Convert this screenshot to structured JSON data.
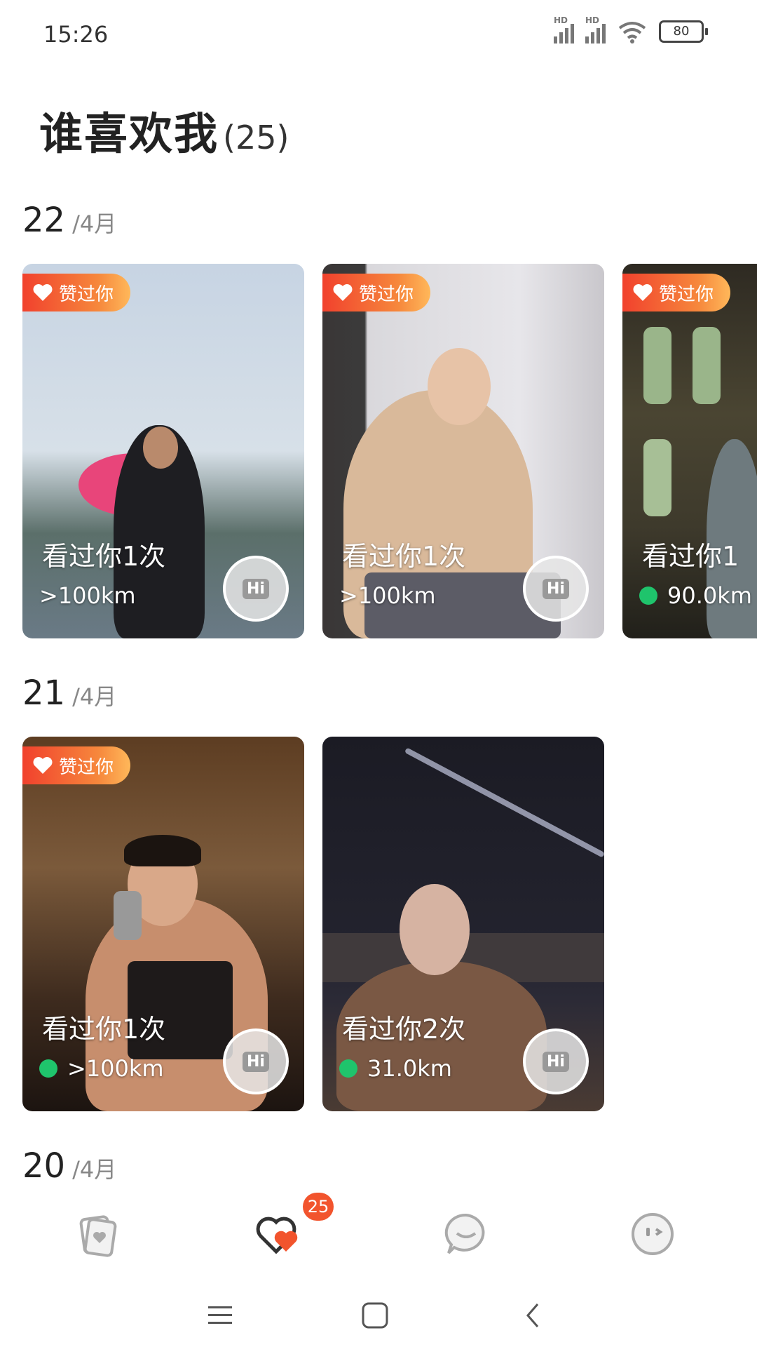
{
  "status_bar": {
    "time": "15:26",
    "battery": "80",
    "hd_label": "HD"
  },
  "header": {
    "title": "谁喜欢我",
    "count": "(25)"
  },
  "groups": [
    {
      "day": "22",
      "month": "/4月"
    },
    {
      "day": "21",
      "month": "/4月"
    },
    {
      "day": "20",
      "month": "/4月"
    }
  ],
  "cards": [
    {
      "badge": "赞过你",
      "seen": "看过你1次",
      "distance": ">100km",
      "online": false
    },
    {
      "badge": "赞过你",
      "seen": "看过你1次",
      "distance": ">100km",
      "online": false
    },
    {
      "badge": "赞过你",
      "seen": "看过你1",
      "distance": "90.0km",
      "online": true
    },
    {
      "badge": "赞过你",
      "seen": "看过你1次",
      "distance": ">100km",
      "online": true
    },
    {
      "badge": "",
      "seen": "看过你2次",
      "distance": "31.0km",
      "online": true
    }
  ],
  "hi_label": "Hi",
  "bottom_nav": {
    "badge_count": "25",
    "items": [
      "cards-icon",
      "likes-heart-icon",
      "chat-bubble-icon",
      "face-icon"
    ]
  },
  "system_nav": [
    "menu-icon",
    "home-icon",
    "back-icon"
  ],
  "colors": {
    "accent": "#f2542d",
    "online": "#1fc46c",
    "badge_gradient_start": "#f1412d",
    "badge_gradient_end": "#ffb85a"
  }
}
